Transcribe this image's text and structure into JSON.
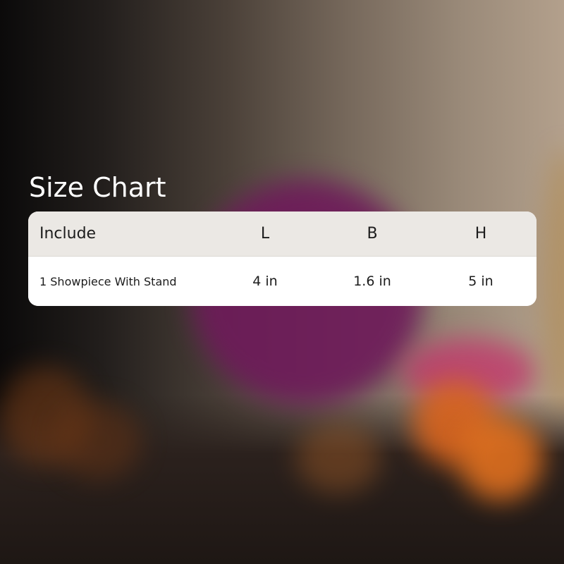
{
  "title": "Size Chart",
  "table": {
    "headers": {
      "include": "Include",
      "l": "L",
      "b": "B",
      "h": "H"
    },
    "rows": [
      {
        "include": "1 Showpiece With Stand",
        "l": "4 in",
        "b": "1.6 in",
        "h": "5 in"
      }
    ]
  },
  "colors": {
    "header_bg": "#ebe8e4",
    "card_bg": "#ffffff",
    "title_text": "#ffffff",
    "body_text": "#1c1c1c"
  }
}
